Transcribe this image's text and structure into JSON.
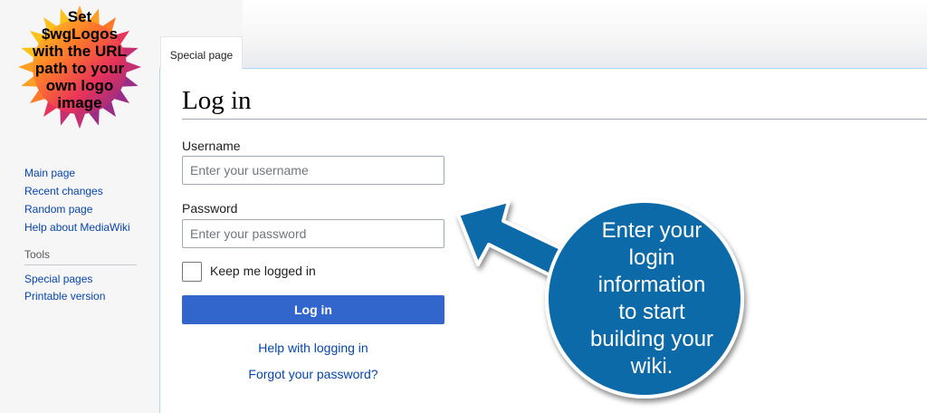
{
  "logo": {
    "lines": [
      "Set",
      "$wgLogos",
      "with the URL",
      "path to your",
      "own logo",
      "image"
    ]
  },
  "sidebar": {
    "nav": [
      "Main page",
      "Recent changes",
      "Random page",
      "Help about MediaWiki"
    ],
    "tools_heading": "Tools",
    "tools": [
      "Special pages",
      "Printable version"
    ]
  },
  "tab": {
    "label": "Special page"
  },
  "page": {
    "title": "Log in",
    "username_label": "Username",
    "username_placeholder": "Enter your username",
    "password_label": "Password",
    "password_placeholder": "Enter your password",
    "keep_logged_in": "Keep me logged in",
    "login_button": "Log in",
    "help_link": "Help with logging in",
    "forgot_link": "Forgot your password?"
  },
  "annotation": {
    "lines": [
      "Enter your",
      "login",
      "information",
      "to start",
      "building your",
      "wiki."
    ],
    "color": "#0e6aa8"
  }
}
